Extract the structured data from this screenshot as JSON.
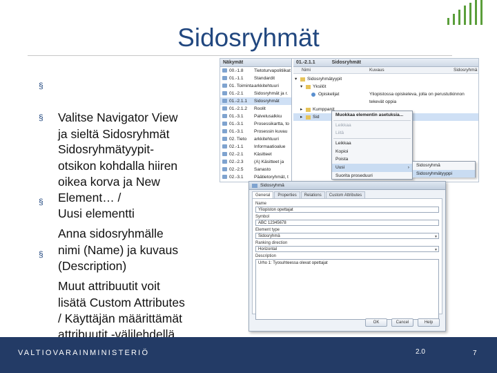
{
  "slide": {
    "title": "Sidosryhmät",
    "bullets": [
      "Valitse Navigator View\nja sieltä Sidosryhmät",
      "Sidosryhmätyypit-\notsikon kohdalla hiiren\noikea korva ja New\nElement… /\nUusi elementti",
      "Anna sidosryhmälle\nnimi (Name) ja kuvaus\n(Description)",
      "Muut attribuutit voit\nlisätä Custom Attributes\n/ Käyttäjän määrittämät\nattribuutit -välilehdellä"
    ],
    "bullet_marker": "§"
  },
  "navigator": {
    "header": "Näkymät",
    "rows": [
      {
        "code": "00.-1.8",
        "label": "Tietoturvapolitiikat"
      },
      {
        "code": "01.-1.1",
        "label": "Standardit"
      },
      {
        "code": "01. Toiminta",
        "label": "arkkitehtuuri"
      },
      {
        "code": "01.-2.1",
        "label": "Sidosryhmät ja r."
      },
      {
        "code": "01.-2.1.1",
        "label": "Sidosryhmät"
      },
      {
        "code": "01.-2.1.2",
        "label": "Roolit"
      },
      {
        "code": "01.-3.1",
        "label": "Palvelusalkku"
      },
      {
        "code": "01.-3.1",
        "label": "Prosessikartta, to"
      },
      {
        "code": "01.-3.1",
        "label": "Prosessin kuvau"
      },
      {
        "code": "02. Tieto",
        "label": "arkkitehtuuri"
      },
      {
        "code": "02.-1.1",
        "label": "Informaatioalue"
      },
      {
        "code": "02.-2.1",
        "label": "Käsitteet"
      },
      {
        "code": "02.-2.3",
        "label": "(A) Käsitteet ja"
      },
      {
        "code": "02.-2.5",
        "label": "Sanasto"
      },
      {
        "code": "02.-3.1",
        "label": "Päätietoryhmät, t"
      }
    ]
  },
  "tree": {
    "header": "01.-2.1.1",
    "header_title": "Sidosryhmät",
    "col_name": "Nimi",
    "col_desc": "Kuvaus",
    "col_extra": "Sidosryhmä",
    "rows": [
      {
        "label": "Sidosryhmätyypit",
        "desc": ""
      },
      {
        "label": "Yksilöt",
        "desc": ""
      },
      {
        "label": "Opiskelijat",
        "desc": "Yliopistossa opiskeleva, jolla on perustutkinnon"
      },
      {
        "label": "",
        "desc": "tekevät oppia"
      },
      {
        "label": "Kumppanit",
        "desc": ""
      },
      {
        "label": "Sid",
        "desc": ""
      }
    ]
  },
  "context_menu": {
    "items": [
      {
        "label": "Muokkaa elementin asetuksia...",
        "disabled": false
      },
      {
        "label": "Leikkaa",
        "disabled": true
      },
      {
        "label": "Liitä",
        "disabled": true
      },
      {
        "label": "Leikkaa",
        "disabled": false
      },
      {
        "label": "Kopioi",
        "disabled": false
      },
      {
        "label": "Poista",
        "disabled": false
      },
      {
        "label": "Uusi",
        "disabled": false
      },
      {
        "label": "Suorita proseduuri",
        "disabled": false
      }
    ],
    "submenu": [
      "Sidosryhmä",
      "Sidosryhmätyyppi"
    ]
  },
  "dialog": {
    "title": "Sidosryhmä",
    "tabs": [
      "General",
      "Properties",
      "Relations",
      "Custom Attributes"
    ],
    "name_label": "Name",
    "name_value": "Yliopiston opettajat",
    "symbol_label": "Symbol",
    "symbol_value": "ABC 12345678",
    "element_type_label": "Element type",
    "element_type_value": "Sidosryhmä",
    "ranking_label": "Ranking direction",
    "ranking_value": "Horizontal",
    "description_label": "Description",
    "description_value": "Urho 1: Tyosuhteessa olevat opettajat",
    "ok": "OK",
    "cancel": "Cancel",
    "help": "Help"
  },
  "footer": {
    "logo": "VALTIOVARAINMINISTERIÖ",
    "version": "2.0",
    "page": "7"
  }
}
